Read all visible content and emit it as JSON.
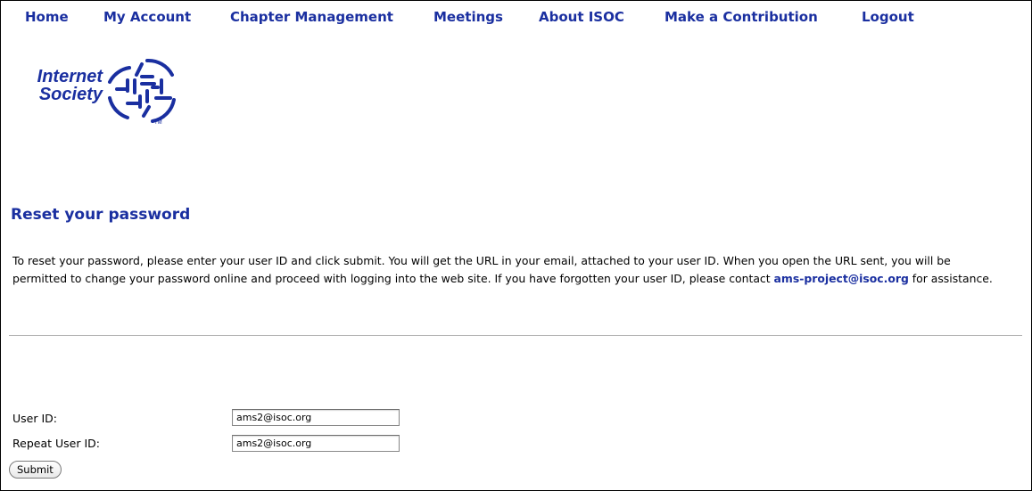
{
  "nav": {
    "items": [
      {
        "label": "Home"
      },
      {
        "label": "My Account"
      },
      {
        "label": "Chapter Management"
      },
      {
        "label": "Meetings"
      },
      {
        "label": "About ISOC"
      },
      {
        "label": "Make a Contribution"
      },
      {
        "label": "Logout"
      }
    ]
  },
  "logo": {
    "line1": "Internet",
    "line2": "Society",
    "tm": "TM"
  },
  "main": {
    "heading": "Reset your password",
    "para_before": "To reset your password, please enter your user ID and click submit. You will get the URL in your email, attached to your user ID. When you open the URL sent, you will be permitted to change your password online and proceed with logging into the web site. If you have forgotten your user ID, please contact ",
    "email_link": "ams-project@isoc.org",
    "para_after": " for assistance."
  },
  "form": {
    "user_id_label": "User ID:",
    "user_id_value": "ams2@isoc.org",
    "repeat_label": "Repeat User ID:",
    "repeat_value": "ams2@isoc.org",
    "submit_label": "Submit"
  },
  "colors": {
    "link_blue": "#1a2fa0"
  }
}
